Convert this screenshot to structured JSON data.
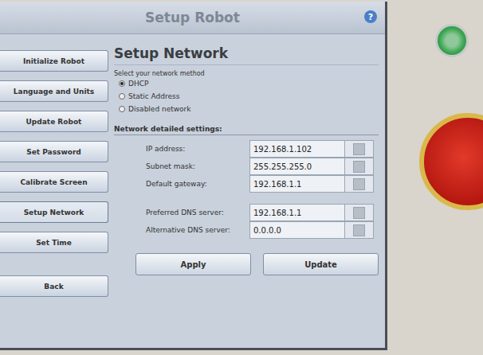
{
  "window": {
    "title": "Setup Robot",
    "help": "?"
  },
  "sidebar": {
    "items": [
      {
        "label": "Initialize Robot",
        "selected": false
      },
      {
        "label": "Language and Units",
        "selected": false
      },
      {
        "label": "Update Robot",
        "selected": false
      },
      {
        "label": "Set Password",
        "selected": false
      },
      {
        "label": "Calibrate Screen",
        "selected": false
      },
      {
        "label": "Setup Network",
        "selected": true
      },
      {
        "label": "Set Time",
        "selected": false
      }
    ],
    "back": "Back"
  },
  "panel": {
    "title": "Setup Network",
    "method_prompt": "Select your network method",
    "methods": [
      {
        "label": "DHCP",
        "selected": true
      },
      {
        "label": "Static Address",
        "selected": false
      },
      {
        "label": "Disabled network",
        "selected": false
      }
    ],
    "details_title": "Network detailed settings:",
    "fields": [
      {
        "label": "IP address:",
        "value": "192.168.1.102"
      },
      {
        "label": "Subnet mask:",
        "value": "255.255.255.0"
      },
      {
        "label": "Default gateway:",
        "value": "192.168.1.1"
      },
      {
        "label": "Preferred DNS server:",
        "value": "192.168.1.1"
      },
      {
        "label": "Alternative DNS server:",
        "value": "0.0.0.0"
      }
    ],
    "buttons": [
      "Apply",
      "Update"
    ]
  }
}
